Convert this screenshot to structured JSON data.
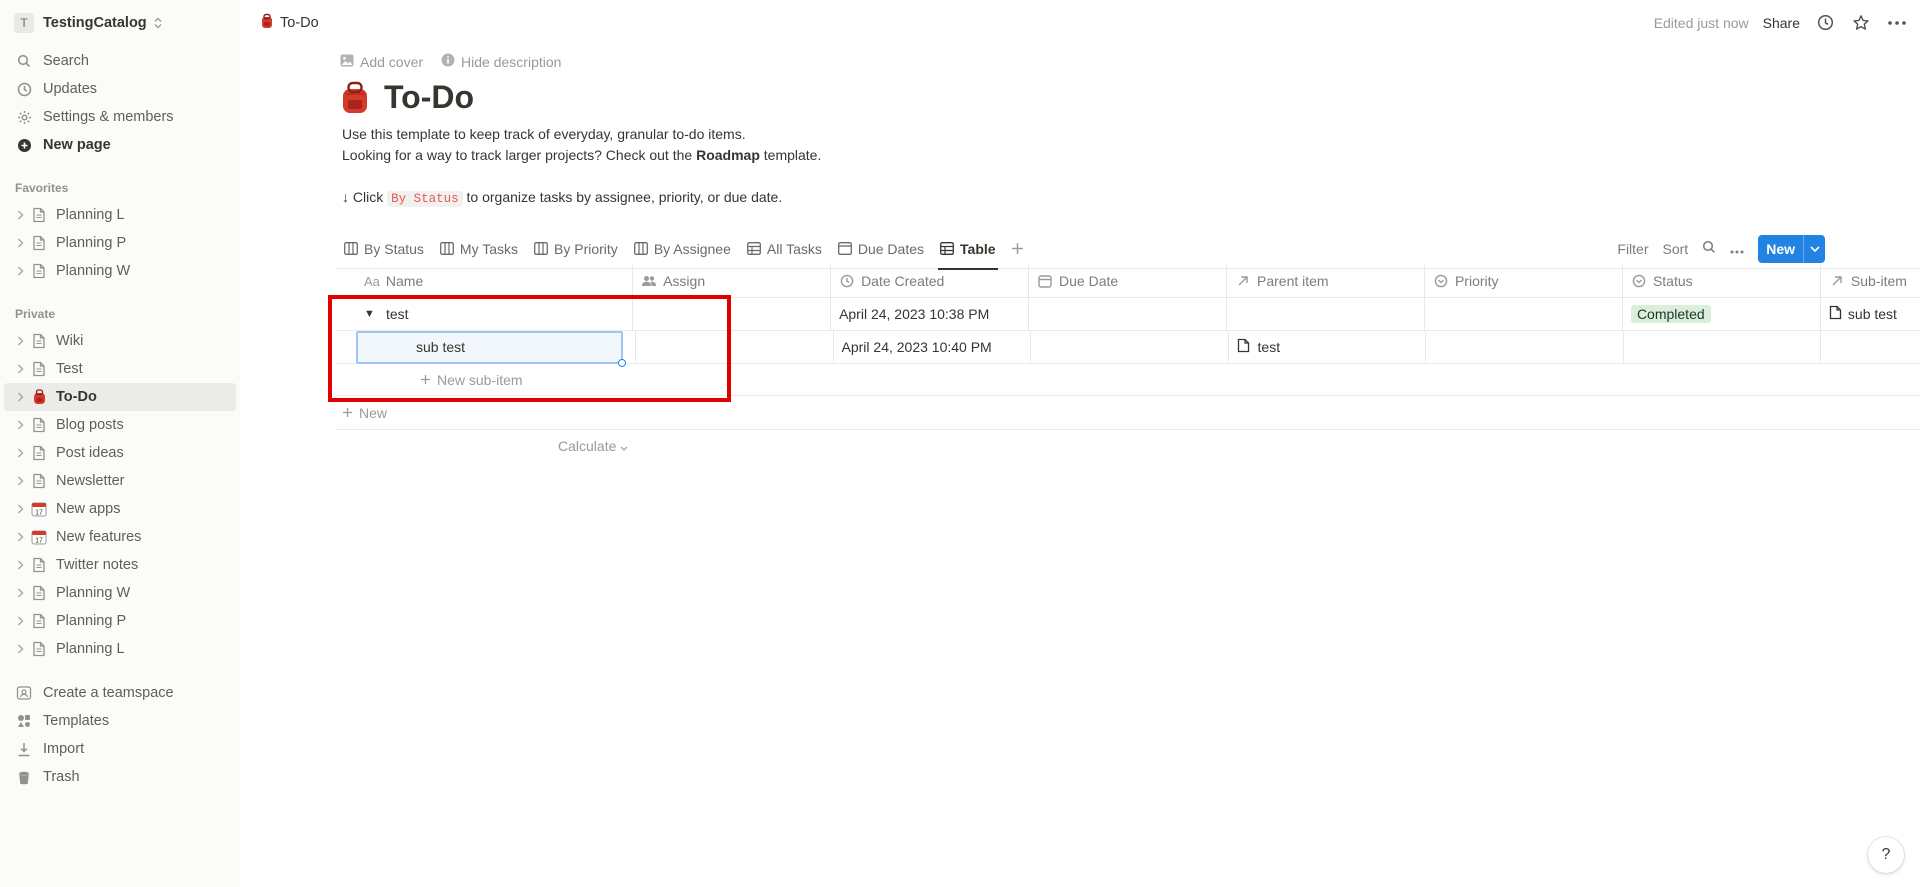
{
  "workspace": {
    "initial": "T",
    "name": "TestingCatalog"
  },
  "sidebar": {
    "nav": [
      {
        "label": "Search",
        "icon": "search-icon"
      },
      {
        "label": "Updates",
        "icon": "clock-icon"
      },
      {
        "label": "Settings & members",
        "icon": "gear-icon"
      },
      {
        "label": "New page",
        "icon": "plus-circle-icon"
      }
    ],
    "favorites_title": "Favorites",
    "favorites": [
      "Planning L",
      "Planning P",
      "Planning W"
    ],
    "private_title": "Private",
    "private": [
      {
        "label": "Wiki",
        "icon": "page-icon"
      },
      {
        "label": "Test",
        "icon": "page-icon"
      },
      {
        "label": "To-Do",
        "icon": "backpack-icon"
      },
      {
        "label": "Blog posts",
        "icon": "page-icon"
      },
      {
        "label": "Post ideas",
        "icon": "page-icon"
      },
      {
        "label": "Newsletter",
        "icon": "page-icon"
      },
      {
        "label": "New apps",
        "icon": "calendar-icon"
      },
      {
        "label": "New features",
        "icon": "calendar-icon"
      },
      {
        "label": "Twitter notes",
        "icon": "page-icon"
      },
      {
        "label": "Planning W",
        "icon": "page-icon"
      },
      {
        "label": "Planning P",
        "icon": "page-icon"
      },
      {
        "label": "Planning L",
        "icon": "page-icon"
      }
    ],
    "bottom": [
      {
        "label": "Create a teamspace",
        "icon": "teamspace-icon"
      },
      {
        "label": "Templates",
        "icon": "templates-icon"
      },
      {
        "label": "Import",
        "icon": "import-icon"
      },
      {
        "label": "Trash",
        "icon": "trash-icon"
      }
    ]
  },
  "topbar": {
    "breadcrumb": "To-Do",
    "edited": "Edited just now",
    "share": "Share"
  },
  "page": {
    "add_cover": "Add cover",
    "hide_description": "Hide description",
    "title": "To-Do",
    "desc_line1": "Use this template to keep track of everyday, granular to-do items.",
    "desc_line2_pre": "Looking for a way to track larger projects? Check out the ",
    "desc_line2_bold": "Roadmap",
    "desc_line2_post": " template.",
    "desc_line3_pre": "↓ Click ",
    "desc_line3_code": "By Status",
    "desc_line3_post": " to organize tasks by assignee, priority, or due date."
  },
  "views": {
    "tabs": [
      {
        "label": "By Status",
        "icon": "board-icon"
      },
      {
        "label": "My Tasks",
        "icon": "board-icon"
      },
      {
        "label": "By Priority",
        "icon": "board-icon"
      },
      {
        "label": "By Assignee",
        "icon": "board-icon"
      },
      {
        "label": "All Tasks",
        "icon": "table-icon"
      },
      {
        "label": "Due Dates",
        "icon": "calendar-view-icon"
      },
      {
        "label": "Table",
        "icon": "table-icon"
      }
    ],
    "active": "Table",
    "filter": "Filter",
    "sort": "Sort",
    "new_button": "New"
  },
  "table": {
    "columns": [
      "Name",
      "Assign",
      "Date Created",
      "Due Date",
      "Parent item",
      "Priority",
      "Status",
      "Sub-item"
    ],
    "column_prefix_aa": "Aa",
    "rows": [
      {
        "name": "test",
        "assign": "",
        "date_created": "April 24, 2023 10:38 PM",
        "due_date": "",
        "parent": "",
        "priority": "",
        "status": "Completed",
        "sub_item": "sub test"
      },
      {
        "name": "sub test",
        "assign": "",
        "date_created": "April 24, 2023 10:40 PM",
        "due_date": "",
        "parent": "test",
        "priority": "",
        "status": "",
        "sub_item": ""
      }
    ],
    "new_sub_item": "New sub-item",
    "new_row": "New",
    "calculate": "Calculate",
    "status_color": "#dbeddb"
  },
  "help": "?"
}
